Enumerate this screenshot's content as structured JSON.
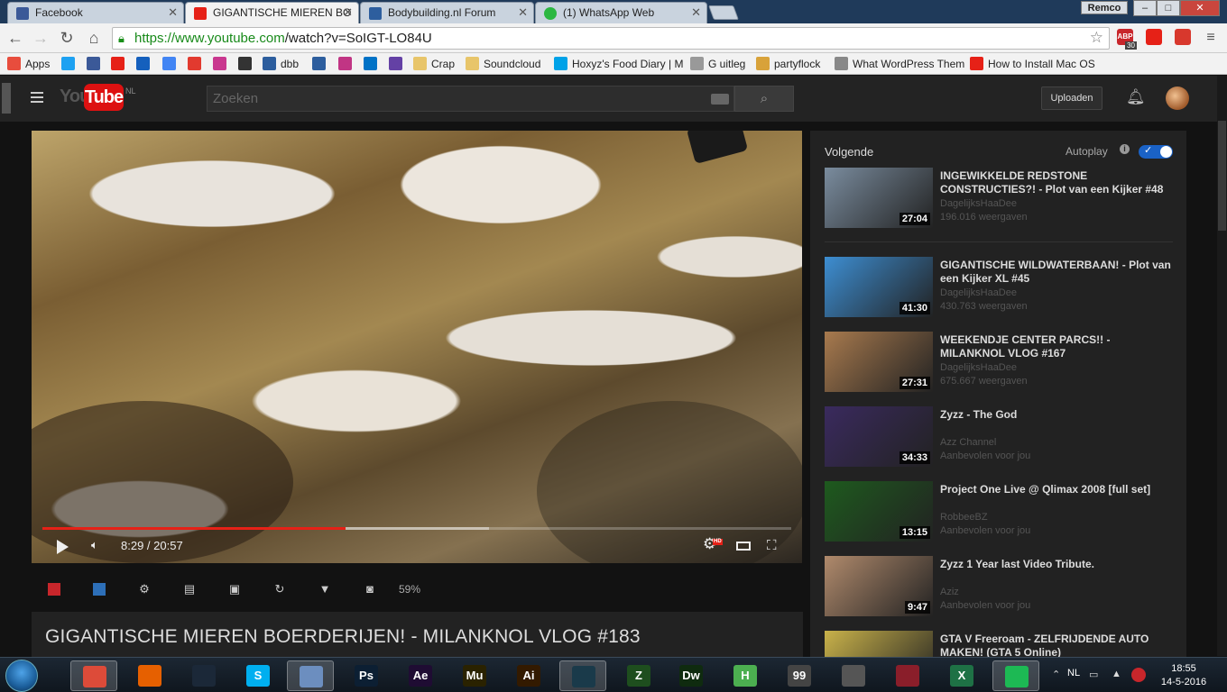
{
  "tabs": [
    {
      "label": "Facebook",
      "color": "#3b5998"
    },
    {
      "label": "GIGANTISCHE MIEREN BO",
      "color": "#e62117"
    },
    {
      "label": "Bodybuilding.nl Forum",
      "color": "#2d5e9e"
    },
    {
      "label": "(1) WhatsApp Web",
      "color": "#2bb741"
    }
  ],
  "window": {
    "user": "Remco",
    "minimize": "–",
    "maximize": "□",
    "close": "✕"
  },
  "toolbar": {
    "url_base": "https://www.youtube.com",
    "url_path": "/watch?v=SoIGT-LO84U",
    "back_icon": "arrow-left-icon",
    "forward_icon": "arrow-right-icon",
    "reload_icon": "reload-icon",
    "home_icon": "home-icon"
  },
  "extensions": [
    {
      "name": "adblock-plus-icon",
      "label": "ABP",
      "badge": "30",
      "color": "#c8262b"
    },
    {
      "name": "youtube-ext-icon",
      "label": "",
      "color": "#e62117"
    },
    {
      "name": "pdf-ext-icon",
      "label": "",
      "color": "#d8382d"
    },
    {
      "name": "red-square-ext-icon",
      "label": "",
      "color": "#c8262b"
    }
  ],
  "bookmarks": [
    {
      "label": "Apps",
      "color": "#e84d3d"
    },
    {
      "label": "",
      "color": "#1da1f2"
    },
    {
      "label": "",
      "color": "#3b5998"
    },
    {
      "label": "",
      "color": "#e62117"
    },
    {
      "label": "",
      "color": "#1560bd"
    },
    {
      "label": "",
      "color": "#4285f4"
    },
    {
      "label": "",
      "color": "#e23a2f"
    },
    {
      "label": "",
      "color": "#c9378f"
    },
    {
      "label": "",
      "color": "#333333"
    },
    {
      "label": "dbb",
      "color": "#2d5e9e"
    },
    {
      "label": "",
      "color": "#2d5e9e"
    },
    {
      "label": "",
      "color": "#c13584"
    },
    {
      "label": "",
      "color": "#0072c6"
    },
    {
      "label": "",
      "color": "#6441a5"
    },
    {
      "label": "Crap",
      "color": "#e8c56a"
    },
    {
      "label": "Soundcloud",
      "color": "#e8c56a"
    },
    {
      "label": "Hoxyz's Food Diary | M",
      "color": "#00a2e8"
    },
    {
      "label": "G uitleg",
      "color": "#999999"
    },
    {
      "label": "partyflock",
      "color": "#d8a23a"
    },
    {
      "label": "What WordPress Them",
      "color": "#888888"
    },
    {
      "label": "How to Install Mac OS",
      "color": "#e62117"
    }
  ],
  "masthead": {
    "logo_you": "You",
    "logo_tube": "Tube",
    "logo_region": "NL",
    "search_placeholder": "Zoeken",
    "upload_label": "Uploaden"
  },
  "player": {
    "current_time": "8:29",
    "duration": "20:57",
    "time_text": "8:29 / 20:57",
    "hd_badge": "HD",
    "progress_played": 0.405,
    "progress_loaded": 0.596
  },
  "ext_toolbar": {
    "icons": [
      "red-flag-icon",
      "blue-square-icon",
      "gear-icon",
      "film-icon",
      "picture-icon",
      "loop-icon",
      "filter-icon",
      "camera-icon"
    ],
    "percent": "59%"
  },
  "video": {
    "title": "GIGANTISCHE MIEREN BOERDERIJEN! - MILANKNOL VLOG #183"
  },
  "sidebar": {
    "heading": "Volgende",
    "autoplay_label": "Autoplay",
    "autoplay_on": true,
    "videos": [
      {
        "title": "INGEWIKKELDE REDSTONE CONSTRUCTIES?! - Plot van een Kijker #48",
        "channel": "DagelijksHaaDee",
        "meta": "196.016 weergaven",
        "duration": "27:04",
        "thumb": "#7a8c9e"
      },
      {
        "title": "GIGANTISCHE WILDWATERBAAN! - Plot van een Kijker XL #45",
        "channel": "DagelijksHaaDee",
        "meta": "430.763 weergaven",
        "duration": "41:30",
        "thumb": "#3d8ed2"
      },
      {
        "title": "WEEKENDJE CENTER PARCS!! - MILANKNOL VLOG #167",
        "channel": "DagelijksHaaDee",
        "meta": "675.667 weergaven",
        "duration": "27:31",
        "thumb": "#a87a4e"
      },
      {
        "title": "Zyzz - The God",
        "channel": "Azz Channel",
        "meta": "Aanbevolen voor jou",
        "duration": "34:33",
        "thumb": "#3a2a5e"
      },
      {
        "title": "Project One Live @ Qlimax 2008 [full set]",
        "channel": "RobbeeBZ",
        "meta": "Aanbevolen voor jou",
        "duration": "13:15",
        "thumb": "#1e5a1e"
      },
      {
        "title": "Zyzz 1 Year last Video Tribute.",
        "channel": "Aziz",
        "meta": "Aanbevolen voor jou",
        "duration": "9:47",
        "thumb": "#b08a6c"
      },
      {
        "title": "GTA V Freeroam - ZELFRIJDENDE AUTO MAKEN! (GTA 5 Online)",
        "channel": "",
        "meta": "",
        "duration": "",
        "thumb": "#c9b24a"
      }
    ]
  },
  "taskbar": {
    "apps": [
      {
        "name": "chrome-taskbar-icon",
        "label": "",
        "color": "#dd4b39",
        "active": true
      },
      {
        "name": "firefox-taskbar-icon",
        "label": "",
        "color": "#e66000",
        "active": false
      },
      {
        "name": "steam-taskbar-icon",
        "label": "",
        "color": "#1b2838",
        "active": false
      },
      {
        "name": "skype-taskbar-icon",
        "label": "S",
        "color": "#00aff0",
        "active": false
      },
      {
        "name": "control-panel-taskbar-icon",
        "label": "",
        "color": "#6c8ebf",
        "active": true
      },
      {
        "name": "photoshop-taskbar-icon",
        "label": "Ps",
        "color": "#0c1f33",
        "active": false
      },
      {
        "name": "aftereffects-taskbar-icon",
        "label": "Ae",
        "color": "#1f0c33",
        "active": false
      },
      {
        "name": "muse-taskbar-icon",
        "label": "Mu",
        "color": "#2a2200",
        "active": false
      },
      {
        "name": "illustrator-taskbar-icon",
        "label": "Ai",
        "color": "#331a00",
        "active": false
      },
      {
        "name": "video-editor-taskbar-icon",
        "label": "",
        "color": "#1a3a4a",
        "active": true
      },
      {
        "name": "app-z-taskbar-icon",
        "label": "Z",
        "color": "#1e4e1e",
        "active": false
      },
      {
        "name": "dreamweaver-taskbar-icon",
        "label": "Dw",
        "color": "#0f2b0f",
        "active": false
      },
      {
        "name": "h-app-taskbar-icon",
        "label": "H",
        "color": "#4caf50",
        "active": false
      },
      {
        "name": "99-app-taskbar-icon",
        "label": "99",
        "color": "#444444",
        "active": false
      },
      {
        "name": "circle-app-taskbar-icon",
        "label": "",
        "color": "#555555",
        "active": false
      },
      {
        "name": "game-app-taskbar-icon",
        "label": "",
        "color": "#8a1e2a",
        "active": false
      },
      {
        "name": "excel-taskbar-icon",
        "label": "X",
        "color": "#1e7145",
        "active": false
      },
      {
        "name": "spotify-taskbar-icon",
        "label": "",
        "color": "#1db954",
        "active": true
      }
    ],
    "language": "NL",
    "time": "18:55",
    "date": "14-5-2016"
  }
}
